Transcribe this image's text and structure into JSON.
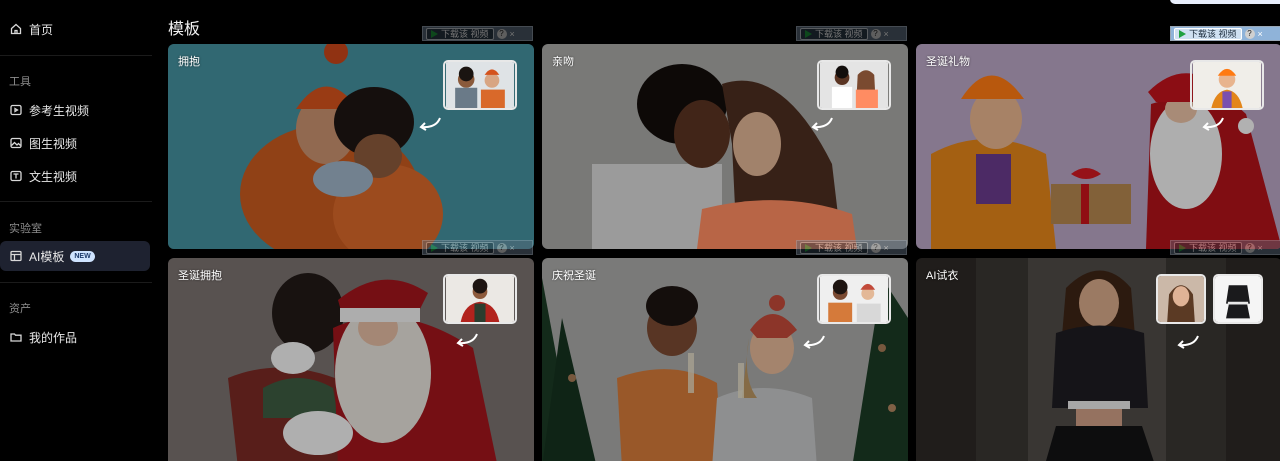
{
  "sidebar": {
    "home": "首页",
    "tools_label": "工具",
    "tools": [
      "参考生视频",
      "图生视频",
      "文生视频"
    ],
    "lab_label": "实验室",
    "lab_item": "AI模板",
    "lab_badge": "NEW",
    "assets_label": "资产",
    "assets_item": "我的作品"
  },
  "main": {
    "title": "模板",
    "cards": [
      {
        "title": "拥抱"
      },
      {
        "title": "亲吻"
      },
      {
        "title": "圣诞礼物"
      },
      {
        "title": "圣诞拥抱"
      },
      {
        "title": "庆祝圣诞"
      },
      {
        "title": "AI试衣"
      }
    ]
  },
  "download_bar": {
    "label": "下载该 视频",
    "help": "?",
    "close": "×"
  }
}
